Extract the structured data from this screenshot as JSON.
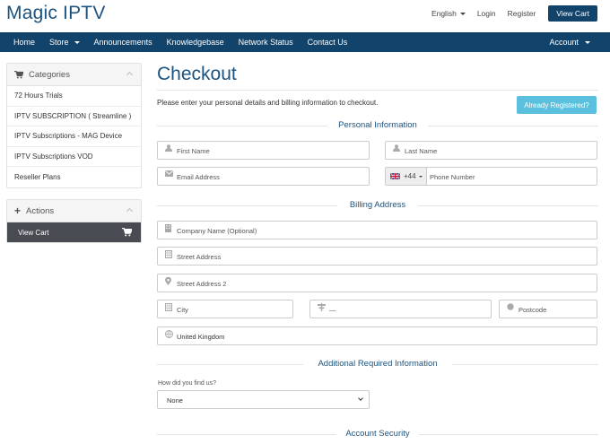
{
  "brand": "Magic IPTV",
  "top": {
    "language": "English",
    "login": "Login",
    "register": "Register",
    "view_cart": "View Cart"
  },
  "nav": {
    "items": [
      "Home",
      "Store",
      "Announcements",
      "Knowledgebase",
      "Network Status",
      "Contact Us"
    ],
    "account": "Account"
  },
  "sidebar": {
    "categories_title": "Categories",
    "categories": [
      "72 Hours Trials",
      "IPTV SUBSCRIPTION ( Streamline )",
      "IPTV Subscriptions - MAG Device",
      "IPTV Subscriptions VOD",
      "Reseller Plans"
    ],
    "actions_title": "Actions",
    "view_cart": "View Cart"
  },
  "main": {
    "title": "Checkout",
    "intro": "Please enter your personal details and billing information to checkout.",
    "already_registered": "Already Registered?",
    "sections": {
      "personal": "Personal Information",
      "billing": "Billing Address",
      "additional": "Additional Required Information",
      "security": "Account Security"
    },
    "fields": {
      "first_name": "First Name",
      "last_name": "Last Name",
      "email": "Email Address",
      "phone_code": "+44",
      "phone": "Phone Number",
      "company": "Company Name (Optional)",
      "street": "Street Address",
      "street2": "Street Address 2",
      "city": "City",
      "state": "—",
      "postcode": "Postcode",
      "country": "United Kingdom"
    },
    "how_label": "How did you find us?",
    "how_value": "None"
  },
  "colors": {
    "brand": "#1c5380",
    "nav_bg": "#12436a",
    "info_button": "#5bc0de",
    "cart_row": "#484c52"
  }
}
